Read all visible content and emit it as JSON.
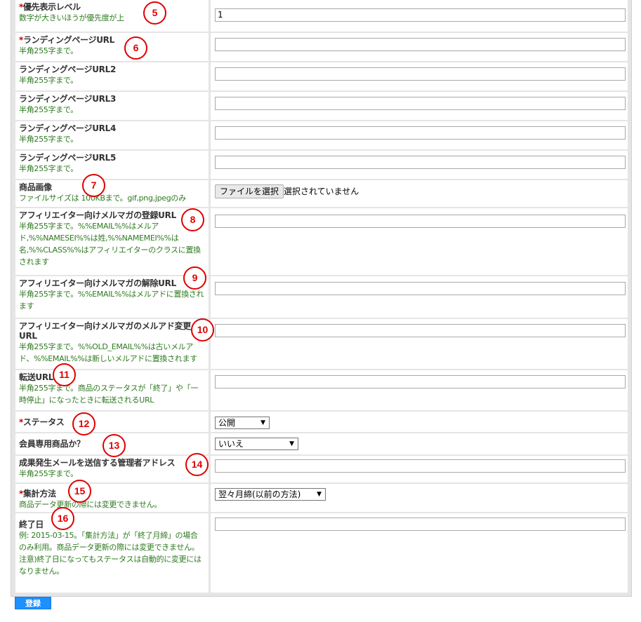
{
  "form": {
    "rows": [
      {
        "required": true,
        "label": "優先表示レベル",
        "hint": "数字が大きいほうが優先度が上",
        "value": "1"
      },
      {
        "required": true,
        "label": "ランディングページURL",
        "hint": "半角255字まで。",
        "value": ""
      },
      {
        "label": "ランディングページURL2",
        "hint": "半角255字まで。",
        "value": ""
      },
      {
        "label": "ランディングページURL3",
        "hint": "半角255字まで。",
        "value": ""
      },
      {
        "label": "ランディングページURL4",
        "hint": "半角255字まで。",
        "value": ""
      },
      {
        "label": "ランディングページURL5",
        "hint": "半角255字まで。",
        "value": ""
      },
      {
        "label": "商品画像",
        "hint": "ファイルサイズは 100KBまで。gif,png,jpegのみ",
        "file_button": "ファイルを選択",
        "file_status": "選択されていません"
      },
      {
        "label": "アフィリエイター向けメルマガの登録URL",
        "hint": "半角255字まで。%%EMAIL%%はメルアド,%%NAMESEI%%は姓,%%NAMEMEI%%は名,%%CLASS%%はアフィリエイターのクラスに置換されます",
        "value": ""
      },
      {
        "label": "アフィリエイター向けメルマガの解除URL",
        "hint": "半角255字まで。%%EMAIL%%はメルアドに置換されます",
        "value": ""
      },
      {
        "label": "アフィリエイター向けメルマガのメルアド変更URL",
        "hint": "半角255字まで。%%OLD_EMAIL%%は古いメルアド、%%EMAIL%%は新しいメルアドに置換されます",
        "value": ""
      },
      {
        "label": "転送URL",
        "hint": "半角255字まで。商品のステータスが「終了」や「一時停止」になったときに転送されるURL",
        "value": ""
      },
      {
        "required": true,
        "label": "ステータス",
        "hint": "",
        "select_value": "公開"
      },
      {
        "label": "会員専用商品か？",
        "hint": "",
        "select_value": "いいえ"
      },
      {
        "label": "成果発生メールを送信する管理者アドレス",
        "hint": "半角255字まで。",
        "value": ""
      },
      {
        "required": true,
        "label": "集計方法",
        "hint": "商品データ更新の際には変更できません。",
        "select_value": "翌々月締(以前の方法)"
      },
      {
        "label": "終了日",
        "hint": "例: 2015-03-15。「集計方法」が「終了月締」の場合のみ利用。商品データ更新の際には変更できません。\n注意)終了日になってもステータスは自動的に変更にはなりません。",
        "value": ""
      }
    ],
    "required_mark": "*",
    "submit_label": "登録"
  },
  "annotations": [
    "5",
    "6",
    "7",
    "8",
    "9",
    "10",
    "11",
    "12",
    "13",
    "14",
    "15",
    "16"
  ],
  "colors": {
    "required": "#cc0000",
    "hint": "#2d7a1f",
    "badge": "#e00000",
    "submit": "#1e90ff"
  }
}
